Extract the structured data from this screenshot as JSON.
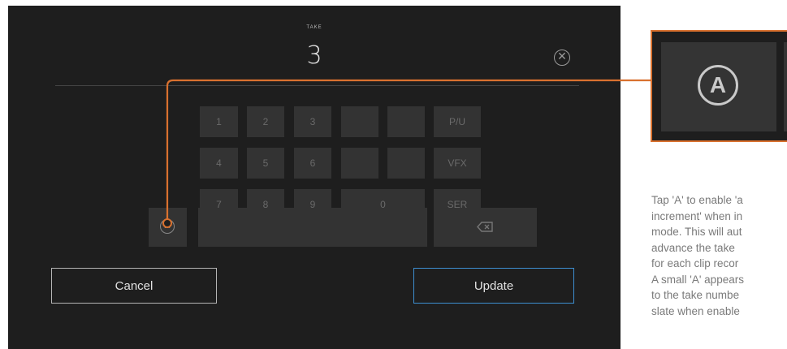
{
  "dialog": {
    "field_label": "TAKE",
    "take_value": "3",
    "clear_icon": "clear-circle-x-icon"
  },
  "keypad": {
    "rows": [
      [
        "1",
        "2",
        "3",
        "",
        "",
        "P/U"
      ],
      [
        "4",
        "5",
        "6",
        "",
        "",
        "VFX"
      ],
      [
        "7",
        "8",
        "9",
        "0",
        "SER"
      ]
    ],
    "auto_increment_icon": "auto-increment-a-icon",
    "backspace_icon": "backspace-icon"
  },
  "buttons": {
    "cancel": "Cancel",
    "update": "Update"
  },
  "callout": {
    "zoom_glyph": "A",
    "lines": [
      "Tap 'A' to enable 'a",
      "increment' when in",
      "mode. This will aut",
      "advance the take",
      "for each clip recor",
      "A small 'A' appears",
      "to the take numbe",
      "slate when enable"
    ],
    "accent_color": "#d9712f"
  },
  "colors": {
    "panel_bg": "#1e1e1e",
    "key_bg": "#333333",
    "update_border": "#3d8fd1"
  }
}
